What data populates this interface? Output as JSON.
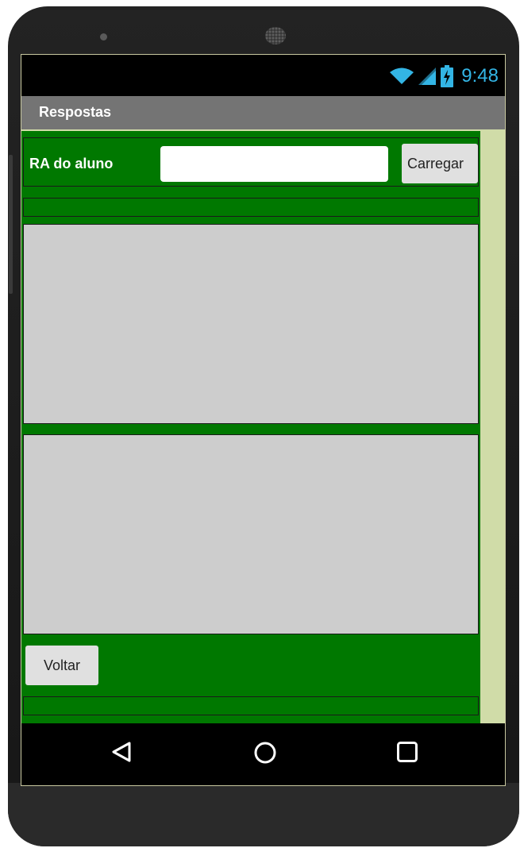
{
  "status_bar": {
    "time": "9:48",
    "icons": [
      "wifi-icon",
      "cell-signal-icon",
      "battery-charging-icon"
    ],
    "accent": "#33b5e5"
  },
  "title_bar": {
    "title": "Respostas"
  },
  "form": {
    "ra_label": "RA do aluno",
    "ra_input_value": "",
    "load_button": "Carregar"
  },
  "footer": {
    "back_button": "Voltar"
  },
  "nav_bar": {
    "icons": [
      "back-triangle-icon",
      "home-circle-icon",
      "recents-square-icon"
    ]
  },
  "colors": {
    "container_green": "#007800",
    "title_bar_gray": "#747474",
    "panel_gray": "#cdcdcd",
    "screen_background": "#d0dca8"
  }
}
